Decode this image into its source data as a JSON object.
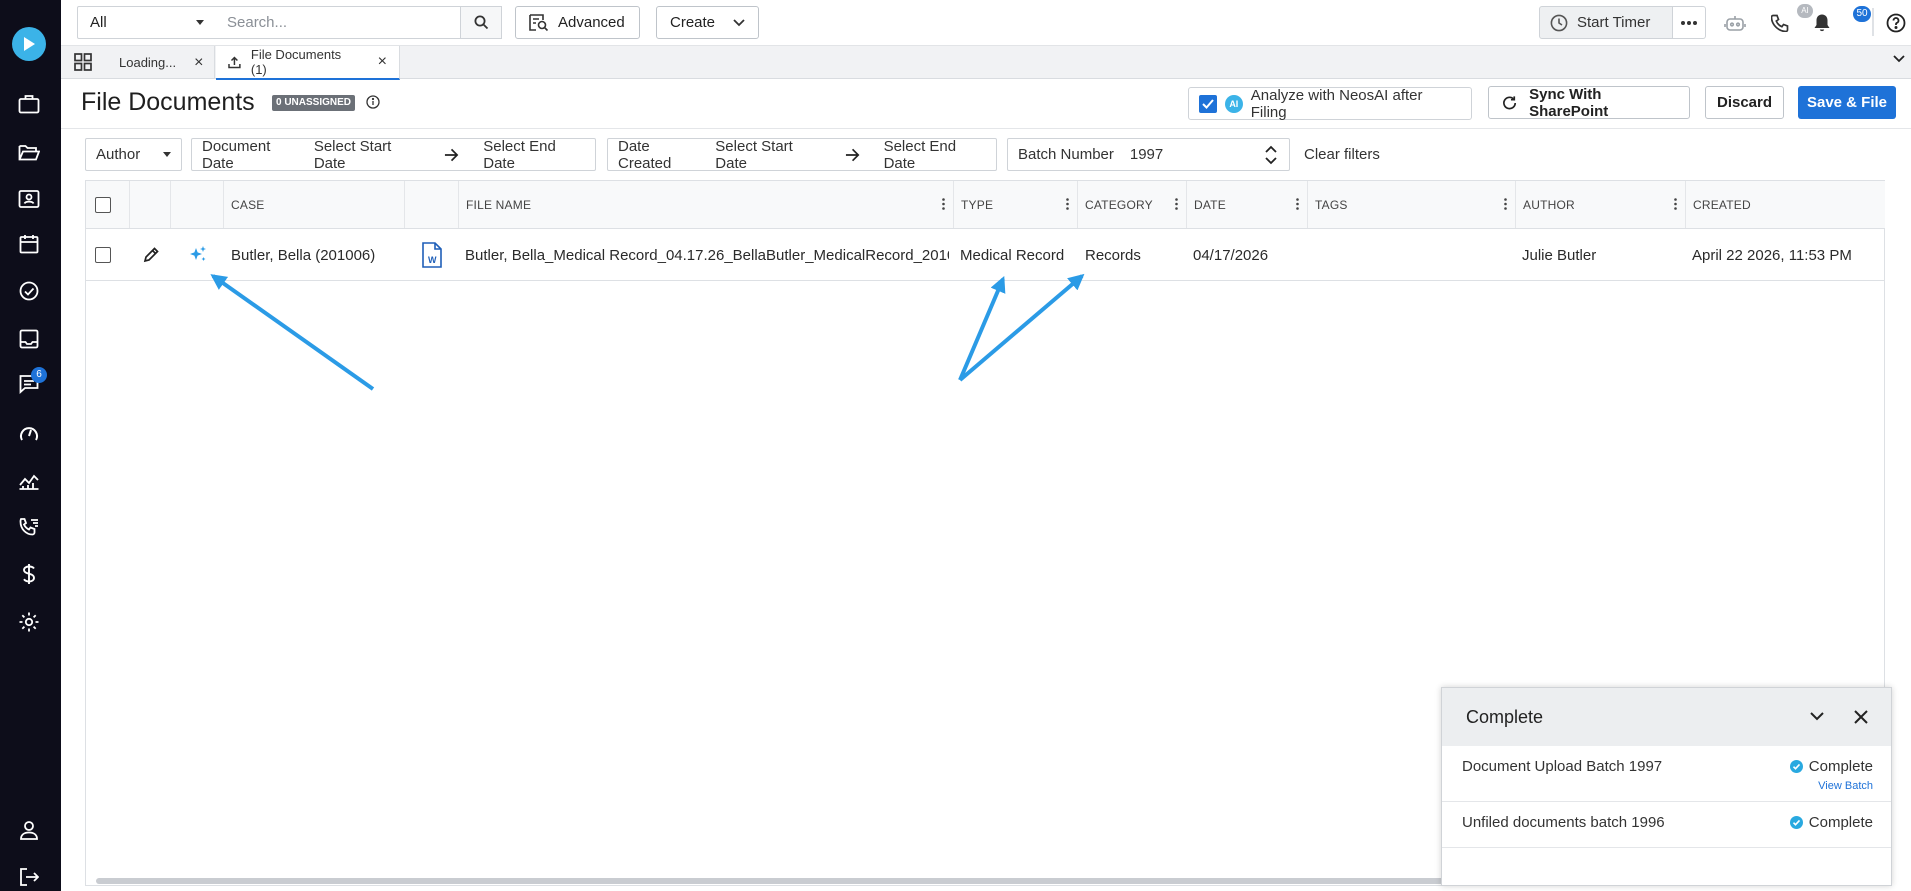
{
  "topbar": {
    "scope_value": "All",
    "search_placeholder": "Search...",
    "advanced_label": "Advanced",
    "create_label": "Create",
    "timer_label": "Start Timer",
    "ai_badge": "AI",
    "notification_count": "50"
  },
  "sidebar": {
    "messages_badge": "6"
  },
  "tabs": [
    {
      "label": "Loading..."
    },
    {
      "label": "File Documents (1)"
    }
  ],
  "page": {
    "title": "File Documents",
    "unassigned_badge": "0 UNASSIGNED",
    "analyze_label": "Analyze with NeosAI after Filing",
    "ai_label": "AI",
    "sync_label": "Sync With SharePoint",
    "discard_label": "Discard",
    "save_label": "Save & File"
  },
  "filters": {
    "author_label": "Author",
    "document_date_label": "Document Date",
    "date_created_label": "Date Created",
    "start_placeholder": "Select Start Date",
    "end_placeholder": "Select End Date",
    "batch_label": "Batch Number",
    "batch_value": "1997",
    "clear_label": "Clear filters"
  },
  "table": {
    "columns": [
      "CASE",
      "FILE NAME",
      "TYPE",
      "CATEGORY",
      "DATE",
      "TAGS",
      "AUTHOR",
      "CREATED"
    ],
    "rows": [
      {
        "case": "Butler, Bella (201006)",
        "file_name": "Butler, Bella_Medical Record_04.17.26_BellaButler_MedicalRecord_2010...",
        "type": "Medical Record",
        "category": "Records",
        "date": "04/17/2026",
        "tags": "",
        "author": "Julie Butler",
        "created": "April 22 2026, 11:53 PM"
      }
    ]
  },
  "panel": {
    "title": "Complete",
    "items": [
      {
        "name": "Document Upload Batch 1997",
        "status": "Complete",
        "link": "View Batch"
      },
      {
        "name": "Unfiled documents batch 1996",
        "status": "Complete"
      }
    ]
  },
  "colors": {
    "accent": "#1e72d8",
    "sidebar": "#0d0d1a",
    "logo": "#3bb3e8",
    "annotation_arrow": "#2b9be6"
  }
}
